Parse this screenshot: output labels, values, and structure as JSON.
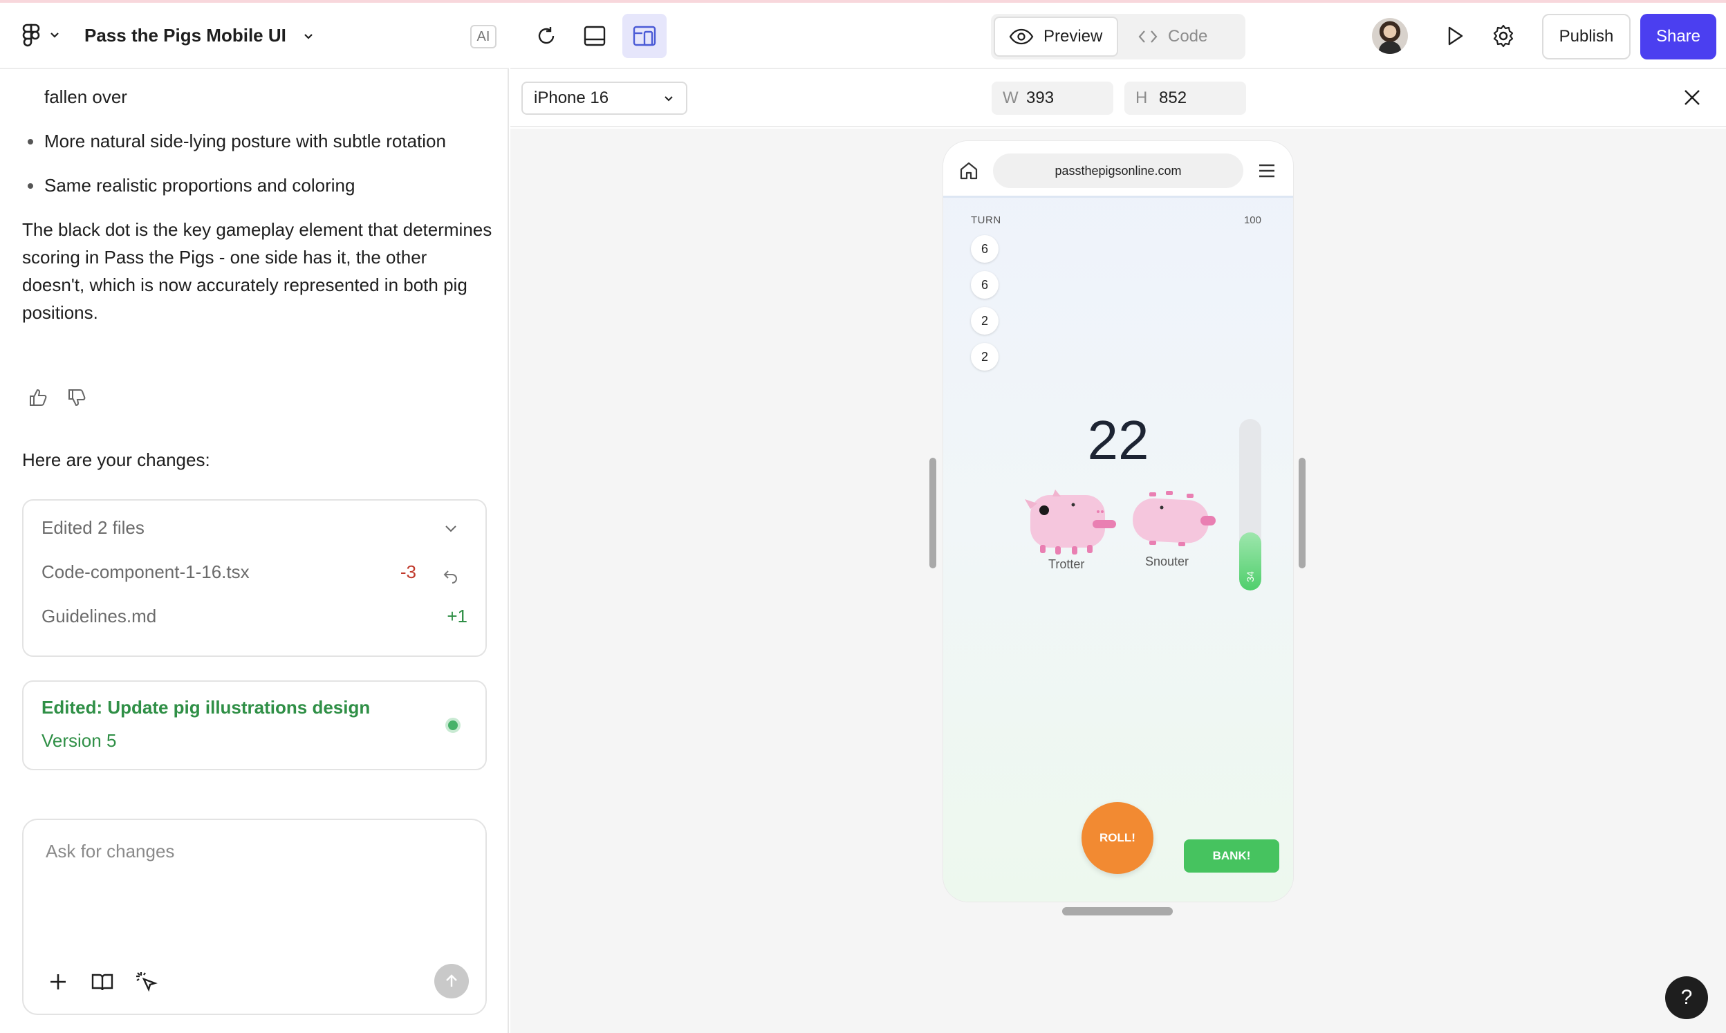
{
  "app": {
    "project_title": "Pass the Pigs Mobile UI",
    "ai_badge": "AI"
  },
  "chat": {
    "partial_line": "fallen over",
    "bullets": [
      "More natural side-lying posture with subtle rotation",
      "Same realistic proportions and coloring"
    ],
    "paragraph": "The black dot is the key gameplay element that determines scoring in Pass the Pigs - one side has it, the other doesn't, which is now accurately represented in both pig positions.",
    "changes_title": "Here are your changes:",
    "files_card": {
      "summary": "Edited 2 files",
      "files": [
        {
          "name": "Code-component-1-16.tsx",
          "delta": "-3"
        },
        {
          "name": "Guidelines.md",
          "delta": "+1"
        }
      ]
    },
    "edit_card": {
      "title": "Edited: Update pig illustrations design",
      "version": "Version 5"
    },
    "composer_placeholder": "Ask for changes"
  },
  "toolbar": {
    "preview_label": "Preview",
    "code_label": "Code",
    "publish_label": "Publish",
    "share_label": "Share"
  },
  "preview": {
    "device": "iPhone 16",
    "width_label": "W",
    "width": "393",
    "height_label": "H",
    "height": "852"
  },
  "game": {
    "url": "passthepigsonline.com",
    "turn_label": "TURN",
    "target": "100",
    "turn_scores": [
      "6",
      "6",
      "2",
      "2"
    ],
    "round_score": "22",
    "pigs": [
      {
        "name": "Trotter"
      },
      {
        "name": "Snouter"
      }
    ],
    "meter_value": "34",
    "meter_fraction": 0.34,
    "roll_label": "ROLL!",
    "bank_label": "BANK!"
  },
  "help_label": "?",
  "colors": {
    "accent": "#4b3ff0",
    "success": "#2f8f46",
    "danger": "#c0392b",
    "roll": "#f28a32",
    "bank": "#46c35f",
    "pig": "#f5c6dd"
  }
}
